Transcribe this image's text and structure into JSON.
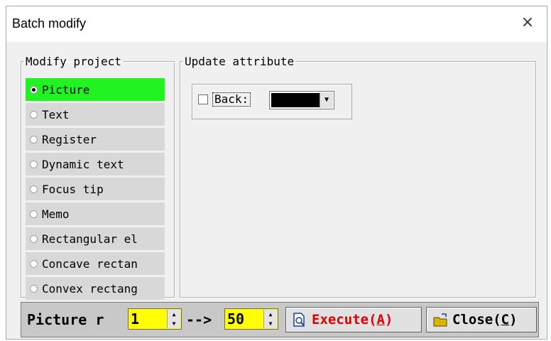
{
  "window": {
    "title": "Batch modify",
    "close_glyph": "×"
  },
  "modify_project": {
    "legend": "Modify project",
    "items": [
      {
        "label": "Picture",
        "selected": true
      },
      {
        "label": "Text",
        "selected": false
      },
      {
        "label": "Register",
        "selected": false
      },
      {
        "label": "Dynamic text",
        "selected": false
      },
      {
        "label": "Focus tip",
        "selected": false
      },
      {
        "label": "Memo",
        "selected": false
      },
      {
        "label": "Rectangular el",
        "selected": false
      },
      {
        "label": "Concave rectan",
        "selected": false
      },
      {
        "label": "Convex rectang",
        "selected": false
      }
    ]
  },
  "update_attribute": {
    "legend": "Update attribute",
    "back_label": "Back:",
    "back_checked": false,
    "back_color": "#000000"
  },
  "bottom": {
    "label": "Picture r",
    "from_value": "1",
    "arrow": "-->",
    "to_value": "50",
    "execute": {
      "text": "Execute(",
      "key": "A",
      "end": ")"
    },
    "close": {
      "text": "Close(",
      "key": "C",
      "end": ")"
    }
  },
  "colors": {
    "selected_bg": "#21f221",
    "spin_bg": "#ffff00",
    "execute_text": "#e00000"
  },
  "icons": [
    "close-icon",
    "radio-icon",
    "checkbox-icon",
    "dropdown-arrow-icon",
    "spin-up-icon",
    "spin-down-icon",
    "preview-doc-icon",
    "folder-close-icon"
  ]
}
